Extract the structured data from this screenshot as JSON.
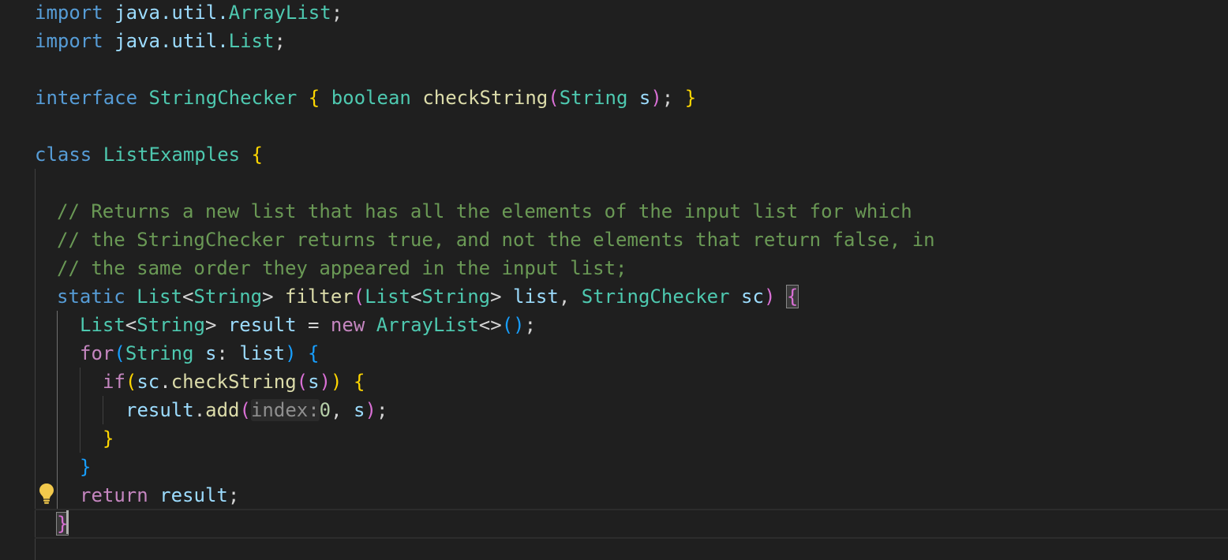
{
  "editor": {
    "language": "java",
    "colors": {
      "background": "#1f1f1f",
      "keyword": "#569cd6",
      "control": "#c586c0",
      "type": "#4ec9b0",
      "variable": "#9cdcfe",
      "function": "#dcdcaa",
      "comment": "#6a9955",
      "number": "#b5cea8",
      "bracket_level1": "#ffd700",
      "bracket_level2": "#da70d6",
      "bracket_level3": "#179fff"
    },
    "code": {
      "l1": {
        "import": "import",
        "path": "java.util.",
        "cls": "ArrayList",
        "semi": ";"
      },
      "l2": {
        "import": "import",
        "path": "java.util.",
        "cls": "List",
        "semi": ";"
      },
      "l4": {
        "kw": "interface",
        "name": "StringChecker",
        "ob": "{",
        "ret": "boolean",
        "method": "checkString",
        "op": "(",
        "ptype": "String",
        "pname": "s",
        "cp": ")",
        "semi": ";",
        "cb": "}"
      },
      "l6": {
        "kw": "class",
        "name": "ListExamples",
        "ob": "{"
      },
      "l8": {
        "text": "// Returns a new list that has all the elements of the input list for which"
      },
      "l9": {
        "text": "// the StringChecker returns true, and not the elements that return false, in"
      },
      "l10": {
        "text": "// the same order they appeared in the input list;"
      },
      "l11": {
        "kw": "static",
        "rtype": "List",
        "lt": "<",
        "gtype": "String",
        "gt": ">",
        "method": "filter",
        "op": "(",
        "p1type": "List",
        "p1lt": "<",
        "p1gtype": "String",
        "p1gt": ">",
        "p1name": "list",
        "comma": ",",
        "p2type": "StringChecker",
        "p2name": "sc",
        "cp": ")",
        "ob": "{"
      },
      "l12": {
        "type": "List",
        "lt": "<",
        "gtype": "String",
        "gt": ">",
        "var": "result",
        "eq": "=",
        "new": "new",
        "ctor": "ArrayList",
        "diamond": "<>",
        "parens": "()",
        "semi": ";"
      },
      "l13": {
        "kw": "for",
        "op": "(",
        "type": "String",
        "var": "s",
        "colon": ":",
        "iter": "list",
        "cp": ")",
        "ob": "{"
      },
      "l14": {
        "kw": "if",
        "op": "(",
        "obj": "sc",
        "dot": ".",
        "method": "checkString",
        "iop": "(",
        "arg": "s",
        "icp": ")",
        "cp": ")",
        "ob": "{"
      },
      "l15": {
        "obj": "result",
        "dot": ".",
        "method": "add",
        "op": "(",
        "hint": "index:",
        "num": "0",
        "comma": ",",
        "arg": "s",
        "cp": ")",
        "semi": ";"
      },
      "l16": {
        "cb": "}"
      },
      "l17": {
        "cb": "}"
      },
      "l18": {
        "kw": "return",
        "var": "result",
        "semi": ";"
      },
      "l19": {
        "cb": "}"
      }
    },
    "gutter_icon": "lightbulb-icon"
  }
}
